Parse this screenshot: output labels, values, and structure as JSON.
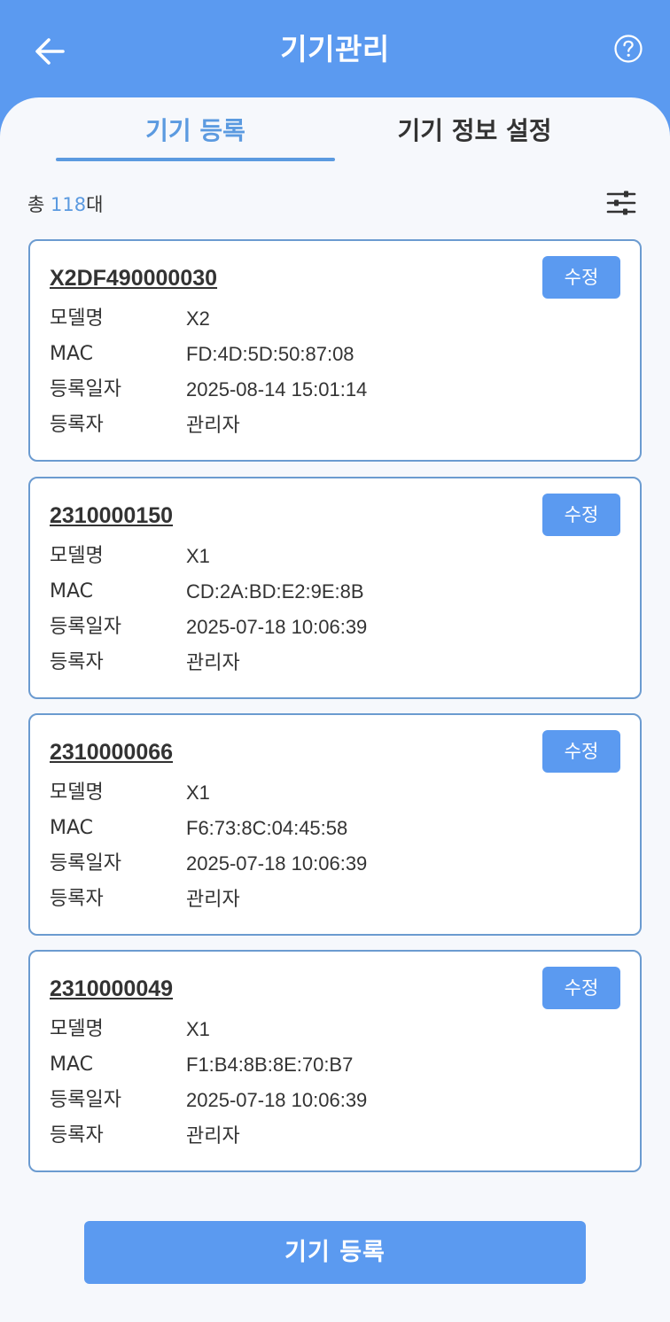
{
  "header": {
    "title": "기기관리",
    "back_icon": "arrow-left-icon",
    "help_icon": "help-circle-icon"
  },
  "tabs": [
    {
      "label": "기기 등록",
      "active": true
    },
    {
      "label": "기기 정보 설정",
      "active": false
    }
  ],
  "summary": {
    "prefix": "총 ",
    "count": "118",
    "suffix": "대",
    "filter_icon": "sliders-icon"
  },
  "devices": [
    {
      "serial": "X2DF490000030",
      "edit_label": "수정",
      "fields": [
        {
          "label": "모델명",
          "value": "X2"
        },
        {
          "label": "MAC",
          "value": "FD:4D:5D:50:87:08"
        },
        {
          "label": "등록일자",
          "value": "2025-08-14 15:01:14"
        },
        {
          "label": "등록자",
          "value": "관리자"
        }
      ]
    },
    {
      "serial": "2310000150",
      "edit_label": "수정",
      "fields": [
        {
          "label": "모델명",
          "value": "X1"
        },
        {
          "label": "MAC",
          "value": "CD:2A:BD:E2:9E:8B"
        },
        {
          "label": "등록일자",
          "value": "2025-07-18 10:06:39"
        },
        {
          "label": "등록자",
          "value": "관리자"
        }
      ]
    },
    {
      "serial": "2310000066",
      "edit_label": "수정",
      "fields": [
        {
          "label": "모델명",
          "value": "X1"
        },
        {
          "label": "MAC",
          "value": "F6:73:8C:04:45:58"
        },
        {
          "label": "등록일자",
          "value": "2025-07-18 10:06:39"
        },
        {
          "label": "등록자",
          "value": "관리자"
        }
      ]
    },
    {
      "serial": "2310000049",
      "edit_label": "수정",
      "fields": [
        {
          "label": "모델명",
          "value": "X1"
        },
        {
          "label": "MAC",
          "value": "F1:B4:8B:8E:70:B7"
        },
        {
          "label": "등록일자",
          "value": "2025-07-18 10:06:39"
        },
        {
          "label": "등록자",
          "value": "관리자"
        }
      ]
    }
  ],
  "footer": {
    "register_label": "기기 등록"
  },
  "colors": {
    "brand": "#5b9af0",
    "accent_text": "#5b9ae0",
    "card_border": "#6b9bd0",
    "background": "#f6f8fc"
  }
}
